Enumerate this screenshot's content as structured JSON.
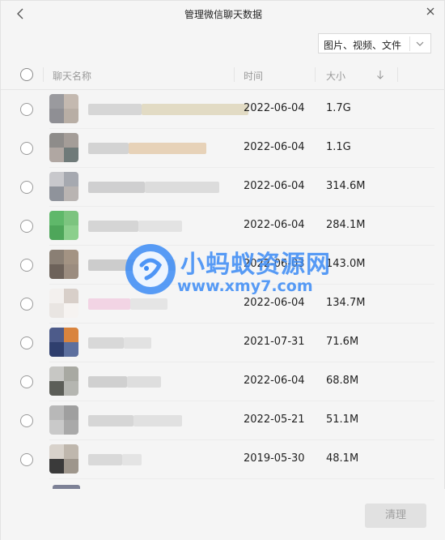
{
  "window": {
    "title": "管理微信聊天数据"
  },
  "filter": {
    "label": "图片、视频、文件"
  },
  "header": {
    "name": "聊天名称",
    "time": "时间",
    "size": "大小"
  },
  "rows": [
    {
      "date": "2022-06-04",
      "size": "1.7G",
      "avatar": [
        "#9a9a9e",
        "#c4b9b0",
        "#8f8f94",
        "#b8aea5"
      ],
      "blur": [
        "#d6d6d6",
        "#e2dbc4"
      ]
    },
    {
      "date": "2022-06-04",
      "size": "1.1G",
      "avatar": [
        "#8e8c8a",
        "#a49d98",
        "#b0a7a2",
        "#6f7a79"
      ],
      "blur": [
        "#d3d3d3",
        "#e7d2b8"
      ]
    },
    {
      "date": "2022-06-04",
      "size": "314.6M",
      "avatar": [
        "#c8c8cc",
        "#a6a9b0",
        "#8f939b",
        "#b9b4b2"
      ],
      "blur": [
        "#cfcfd0",
        "#dcdcdc"
      ]
    },
    {
      "date": "2022-06-04",
      "size": "284.1M",
      "avatar": [
        "#5fb86a",
        "#7cc47f",
        "#4ea65a",
        "#8bcf8c"
      ],
      "blur": [
        "#d5d5d5",
        "#e3e3e3"
      ]
    },
    {
      "date": "2022-06-03",
      "size": "143.0M",
      "avatar": [
        "#8a7f74",
        "#a39383",
        "#6d625a",
        "#9b8c7f"
      ],
      "blur": [
        "#cccccc",
        "#dedede"
      ]
    },
    {
      "date": "2022-06-04",
      "size": "134.7M",
      "avatar": [
        "#f3f0ee",
        "#d8cfc9",
        "#e9e5e2",
        "#f6f3f1"
      ],
      "blur": [
        "#f2d4e4",
        "#e5e5e5"
      ]
    },
    {
      "date": "2021-07-31",
      "size": "71.6M",
      "avatar": [
        "#4d5b8a",
        "#d9843e",
        "#2f3f6e",
        "#5c6f9e"
      ],
      "blur": [
        "#d8d8d8",
        "#e2e2e2"
      ]
    },
    {
      "date": "2022-06-04",
      "size": "68.8M",
      "avatar": [
        "#c7c7c4",
        "#a8a9a2",
        "#5c5e58",
        "#b5b6b1"
      ],
      "blur": [
        "#d0d0d0",
        "#dedede"
      ]
    },
    {
      "date": "2022-05-21",
      "size": "51.1M",
      "avatar": [
        "#b8b8b8",
        "#9f9f9f",
        "#c9c9c9",
        "#a9a9a9"
      ],
      "blur": [
        "#d6d6d6",
        "#e1e1e1"
      ]
    },
    {
      "date": "2019-05-30",
      "size": "48.1M",
      "avatar": [
        "#d8d2cb",
        "#bfb7ad",
        "#3a3a3a",
        "#9e968c"
      ],
      "blur": [
        "#d9d9d9",
        "#e4e4e4"
      ]
    }
  ],
  "footer": {
    "clean_label": "清理"
  },
  "watermark": {
    "text1": "小蚂蚁资源网",
    "text2": "www.xmy7.com"
  },
  "colors": {
    "background": "#f5f5f5",
    "watermark": "#3b8bf5",
    "button_disabled": "#e1e1e1"
  }
}
